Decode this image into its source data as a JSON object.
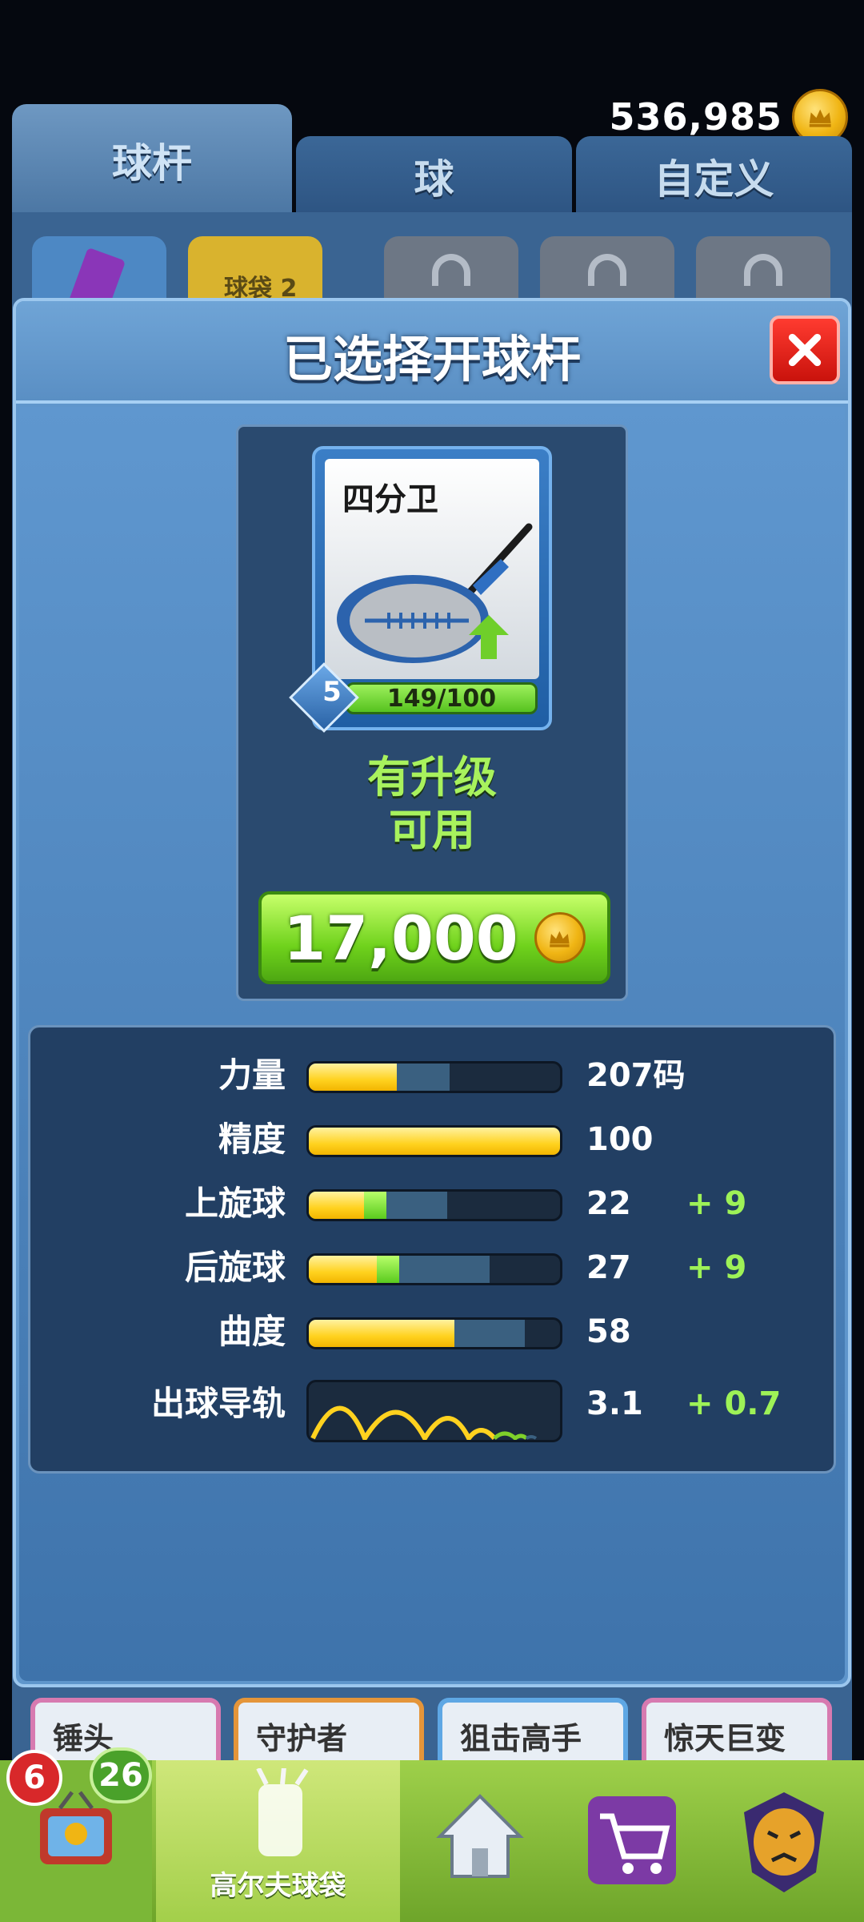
{
  "currency": {
    "amount": "536,985",
    "icon": "crown-coin-icon",
    "color": "#f0b514"
  },
  "tabs": [
    {
      "label": "球杆"
    },
    {
      "label": "球"
    },
    {
      "label": "自定义"
    }
  ],
  "bag_slots": [
    {
      "label": ""
    },
    {
      "label": "球袋 2"
    }
  ],
  "modal": {
    "title": "已选择开球杆",
    "close_icon": "close-icon"
  },
  "club": {
    "name": "四分卫",
    "level": "5",
    "progress": "149/100",
    "upgrade_text_line1": "有升级",
    "upgrade_text_line2": "可用",
    "upgrade_price": "17,000"
  },
  "stats": {
    "power": {
      "label": "力量",
      "value": "207码",
      "fraction": 0.35,
      "max_fraction": 0.56
    },
    "accuracy": {
      "label": "精度",
      "value": "100",
      "fraction": 1.0,
      "max_fraction": 1.0
    },
    "topspin": {
      "label": "上旋球",
      "value": "22",
      "bonus": "+ 9",
      "fraction": 0.22,
      "bonus_fraction": 0.31,
      "max_fraction": 0.55
    },
    "backspin": {
      "label": "后旋球",
      "value": "27",
      "bonus": "+ 9",
      "fraction": 0.27,
      "bonus_fraction": 0.36,
      "max_fraction": 0.72
    },
    "curve": {
      "label": "曲度",
      "value": "58",
      "fraction": 0.58,
      "max_fraction": 0.86
    },
    "guide": {
      "label": "出球导轨",
      "value": "3.1",
      "bonus": "+ 0.7"
    }
  },
  "categories": [
    {
      "label": "锤头"
    },
    {
      "label": "守护者"
    },
    {
      "label": "狙击高手"
    },
    {
      "label": "惊天巨变"
    }
  ],
  "nav": {
    "badge_red": "6",
    "badge_green": "26",
    "golf_bag_label": "高尔夫球袋"
  },
  "colors": {
    "accent_green": "#9ef257",
    "bar_yellow": "#ffd21f",
    "close_red": "#e0221a",
    "panel_blue": "#5f96cc"
  }
}
